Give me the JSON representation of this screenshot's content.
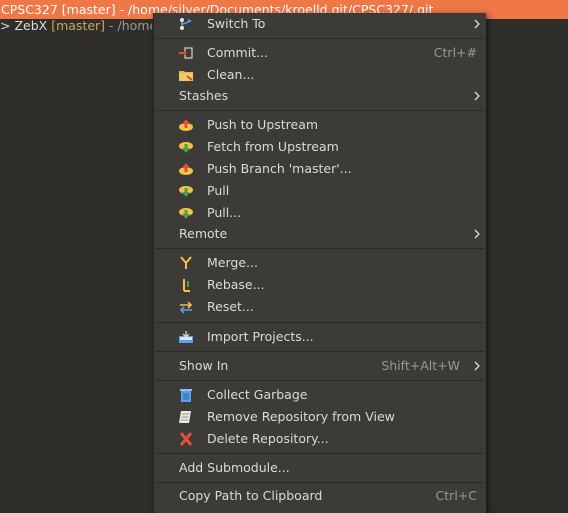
{
  "window": {
    "title": "CPSC327 [master] - /home/silver/Documents/kroelld.git/CPSC327/.git"
  },
  "tree": {
    "arrow": ">",
    "name": "ZebX",
    "branch": "[master]",
    "path": "- /home/s"
  },
  "menu": {
    "switch_to": "Switch To",
    "commit": "Commit...",
    "commit_accel": "Ctrl+#",
    "clean": "Clean...",
    "stashes": "Stashes",
    "push_upstream": "Push to Upstream",
    "fetch_upstream": "Fetch from Upstream",
    "push_branch": "Push Branch 'master'...",
    "pull": "Pull",
    "pull_dialog": "Pull...",
    "remote": "Remote",
    "merge": "Merge...",
    "rebase": "Rebase...",
    "reset": "Reset...",
    "import_projects": "Import Projects...",
    "show_in": "Show In",
    "show_in_accel": "Shift+Alt+W",
    "collect_garbage": "Collect Garbage",
    "remove_repository": "Remove Repository from View",
    "delete_repository": "Delete Repository...",
    "add_submodule": "Add Submodule...",
    "copy_path": "Copy Path to Clipboard",
    "copy_path_accel": "Ctrl+C"
  },
  "icons": {
    "switch": "switch-branch-icon",
    "commit": "commit-icon",
    "clean": "clean-icon",
    "push": "push-icon",
    "fetch": "fetch-icon",
    "pull": "pull-icon",
    "merge": "merge-icon",
    "rebase": "rebase-icon",
    "reset": "reset-icon",
    "import": "import-projects-icon",
    "garbage": "garbage-can-icon",
    "remove": "remove-repository-icon",
    "delete": "delete-x-icon",
    "submenu": "chevron-right-icon"
  },
  "colors": {
    "title_bar": "#f07746",
    "menu_bg": "#3c3b37",
    "background": "#2f2e2b",
    "branch_text": "#c8a85a"
  }
}
